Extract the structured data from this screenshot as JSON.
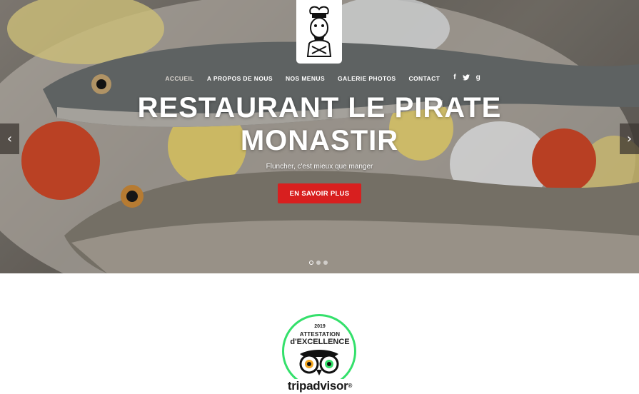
{
  "nav": {
    "items": [
      {
        "label": "ACCUEIL",
        "active": true
      },
      {
        "label": "A PROPOS DE NOUS",
        "active": false
      },
      {
        "label": "NOS MENUS",
        "active": false
      },
      {
        "label": "GALERIE PHOTOS",
        "active": false
      },
      {
        "label": "CONTACT",
        "active": false
      }
    ],
    "social": {
      "facebook": "f",
      "twitter": "🐦",
      "google": "g"
    }
  },
  "hero": {
    "title_line1": "RESTAURANT LE PIRATE",
    "title_line2": "MONASTIR",
    "subtitle": "Fluncher, c'est mieux que manger",
    "cta_label": "EN SAVOIR PLUS",
    "slides": 3,
    "active_slide": 1
  },
  "badge": {
    "year": "2019",
    "line1": "ATTESTATION",
    "line2": "d'EXCELLENCE",
    "brand": "tripadvisor",
    "brand_suffix": "®"
  },
  "colors": {
    "cta": "#d81f1f",
    "badge_ring": "#34e06b"
  }
}
